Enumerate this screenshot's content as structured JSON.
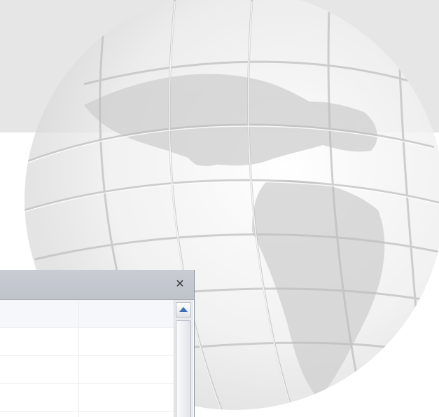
{
  "background": {
    "band_color": "#e6e6e6",
    "watermark": "globe-illustration"
  },
  "dialog": {
    "title": "",
    "close_glyph": "×",
    "close_icon": "close-icon",
    "grid": {
      "columns": [
        "",
        ""
      ],
      "rows": [
        [
          "",
          ""
        ],
        [
          "",
          ""
        ],
        [
          "",
          ""
        ]
      ]
    },
    "scrollbar": {
      "up_icon": "scroll-up-arrow-icon"
    }
  }
}
